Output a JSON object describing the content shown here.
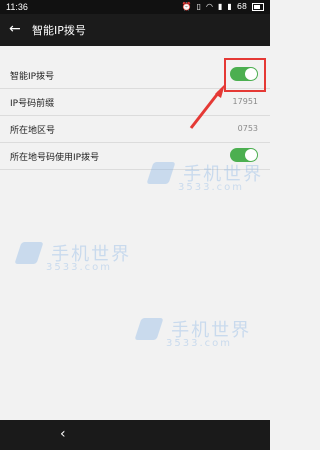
{
  "status_bar": {
    "time": "11:36",
    "battery": "68"
  },
  "app_bar": {
    "title": "智能IP拨号"
  },
  "settings": [
    {
      "label": "智能IP拨号",
      "value": "",
      "toggle": true
    },
    {
      "label": "IP号码前缀",
      "value": "17951",
      "toggle": false
    },
    {
      "label": "所在地区号",
      "value": "0753",
      "toggle": false
    },
    {
      "label": "所在地号码使用IP拨号",
      "value": "",
      "toggle": true
    }
  ],
  "watermark": {
    "main": "手机世界",
    "sub": "3533.com"
  },
  "colors": {
    "accent": "#4caf50",
    "highlight": "#e53935"
  }
}
